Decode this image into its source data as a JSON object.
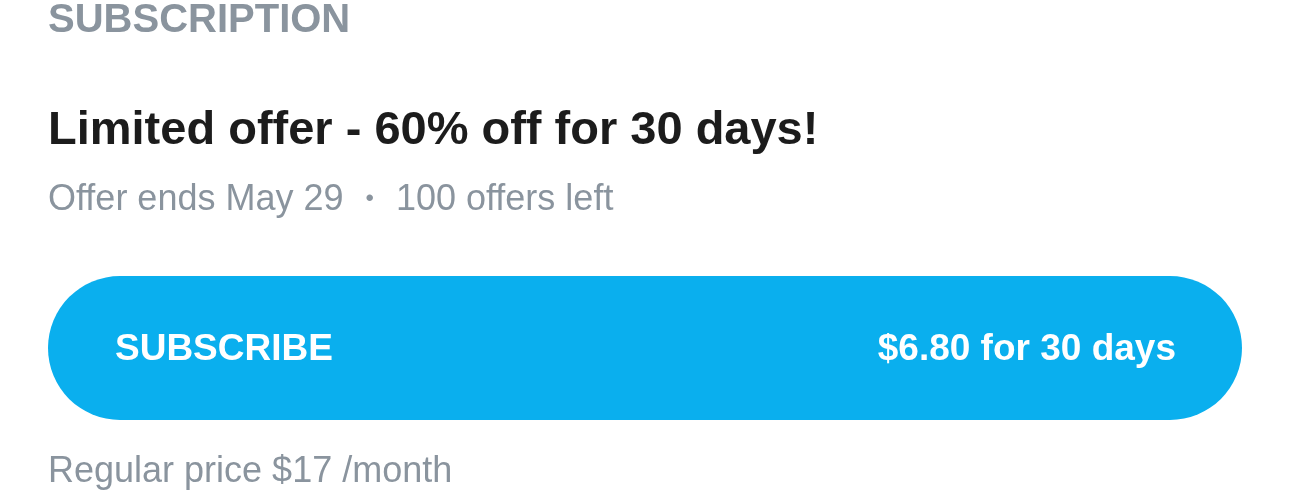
{
  "section_title": "SUBSCRIPTION",
  "offer": {
    "title": "Limited offer - 60% off for 30 days!",
    "ends": "Offer ends May 29",
    "separator": "•",
    "remaining": "100 offers left"
  },
  "subscribe_button": {
    "label": "SUBSCRIBE",
    "price": "$6.80 for 30 days"
  },
  "regular_price": "Regular price $17 /month"
}
